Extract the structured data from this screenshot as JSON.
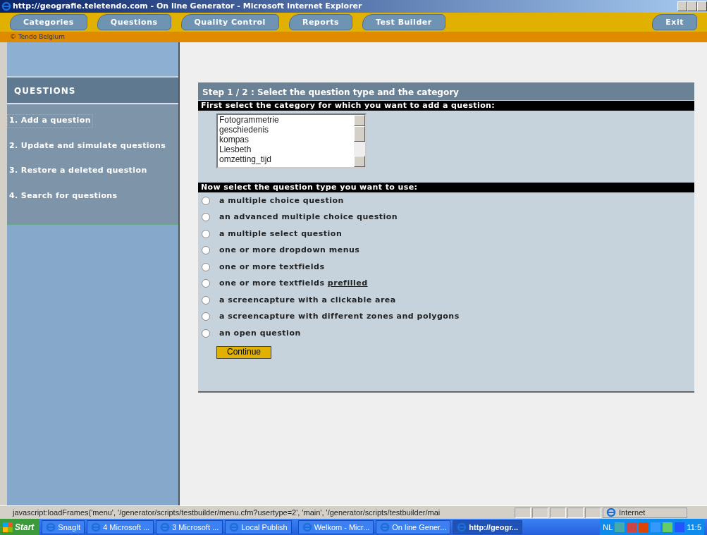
{
  "window": {
    "title": "http://geografie.teletendo.com - On line Generator - Microsoft Internet Explorer"
  },
  "toolbar": {
    "tabs": [
      {
        "label": "Categories"
      },
      {
        "label": "Questions"
      },
      {
        "label": "Quality Control"
      },
      {
        "label": "Reports"
      },
      {
        "label": "Test Builder"
      }
    ],
    "exit": "Exit"
  },
  "copyright": "© Tendo Belgium",
  "sidebar": {
    "title": "QUESTIONS",
    "items": [
      {
        "label": "1. Add a question",
        "selected": true
      },
      {
        "label": "2. Update and simulate questions",
        "selected": false
      },
      {
        "label": "3. Restore a deleted question",
        "selected": false
      },
      {
        "label": "4. Search for questions",
        "selected": false
      }
    ]
  },
  "panel": {
    "title": "Step 1 / 2 : Select the question type and the category",
    "category_heading": "First select the category for which you want to add a question:",
    "categories": [
      {
        "label": "Fotogrammetrie",
        "selected": false
      },
      {
        "label": "geschiedenis",
        "selected": false
      },
      {
        "label": "kompas",
        "selected": false
      },
      {
        "label": "Liesbeth",
        "selected": false
      },
      {
        "label": "omzetting_tijd",
        "selected": false
      }
    ],
    "type_heading": "Now select the question type you want to use:",
    "types": [
      {
        "label": "a multiple choice question",
        "selected": false
      },
      {
        "label": "an advanced multiple choice question",
        "selected": false
      },
      {
        "label": "a multiple select question",
        "selected": false
      },
      {
        "label": "one or more dropdown menus",
        "selected": false
      },
      {
        "label": "one or more textfields",
        "selected": false
      },
      {
        "label": "one or more textfields",
        "link": "prefilled",
        "selected": false
      },
      {
        "label": "a screencapture with a clickable area",
        "selected": false
      },
      {
        "label": "a screencapture with different zones and polygons",
        "selected": false
      },
      {
        "label": "an open question",
        "selected": false
      }
    ],
    "button": "Continue"
  },
  "status_bar": {
    "text": "javascript:loadFrames('menu', '/generator/scripts/testbuilder/menu.cfm?usertype=2', 'main', '/generator/scripts/testbuilder/mai",
    "zone": "Internet"
  },
  "taskbar": {
    "start": "Start",
    "items": [
      {
        "label": "SnagIt",
        "selected": false
      },
      {
        "label": "4 Microsoft ...",
        "selected": false
      },
      {
        "label": "3 Microsoft ...",
        "selected": false
      },
      {
        "label": "Local Publish",
        "selected": false
      },
      {
        "label": "Welkom - Micr...",
        "selected": false
      },
      {
        "label": "On line Gener...",
        "selected": false
      },
      {
        "label": "http://geogr...",
        "selected": true
      }
    ],
    "language": "NL",
    "clock": "11:5"
  }
}
